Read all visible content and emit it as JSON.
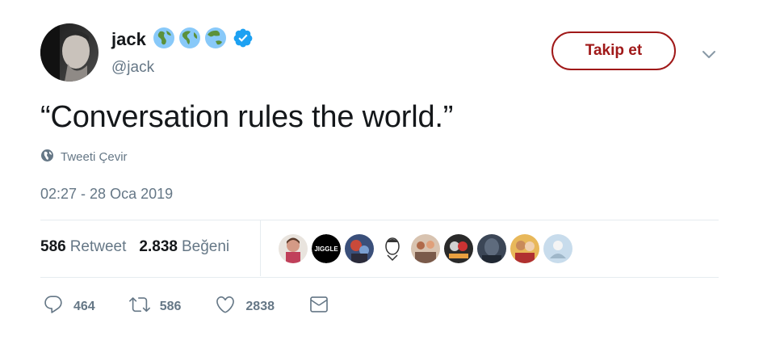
{
  "author": {
    "display_name": "jack",
    "handle": "@jack",
    "name_badges": [
      "globe-europe-africa-icon",
      "globe-americas-icon",
      "globe-asia-australia-icon",
      "verified-badge-icon"
    ]
  },
  "follow_button": {
    "label": "Takip et"
  },
  "tweet": {
    "text": "“Conversation rules the world.”",
    "translate_label": "Tweeti Çevir",
    "timestamp": "02:27 - 28 Oca 2019"
  },
  "stats": {
    "retweets_count": "586",
    "retweets_label": "Retweet",
    "likes_count": "2.838",
    "likes_label": "Beğeni"
  },
  "liker_avatars": [
    {
      "name": "liker-avatar-1"
    },
    {
      "name": "liker-avatar-2",
      "text": "JIGGLE"
    },
    {
      "name": "liker-avatar-3"
    },
    {
      "name": "liker-avatar-4"
    },
    {
      "name": "liker-avatar-5"
    },
    {
      "name": "liker-avatar-6"
    },
    {
      "name": "liker-avatar-7"
    },
    {
      "name": "liker-avatar-8"
    },
    {
      "name": "liker-avatar-9"
    }
  ],
  "actions": {
    "reply_count": "464",
    "retweet_count": "586",
    "like_count": "2838"
  },
  "colors": {
    "text": "#14171a",
    "secondary_text": "#657786",
    "follow_accent": "#a01919",
    "divider": "#e6ecf0",
    "verified": "#1da1f2"
  }
}
